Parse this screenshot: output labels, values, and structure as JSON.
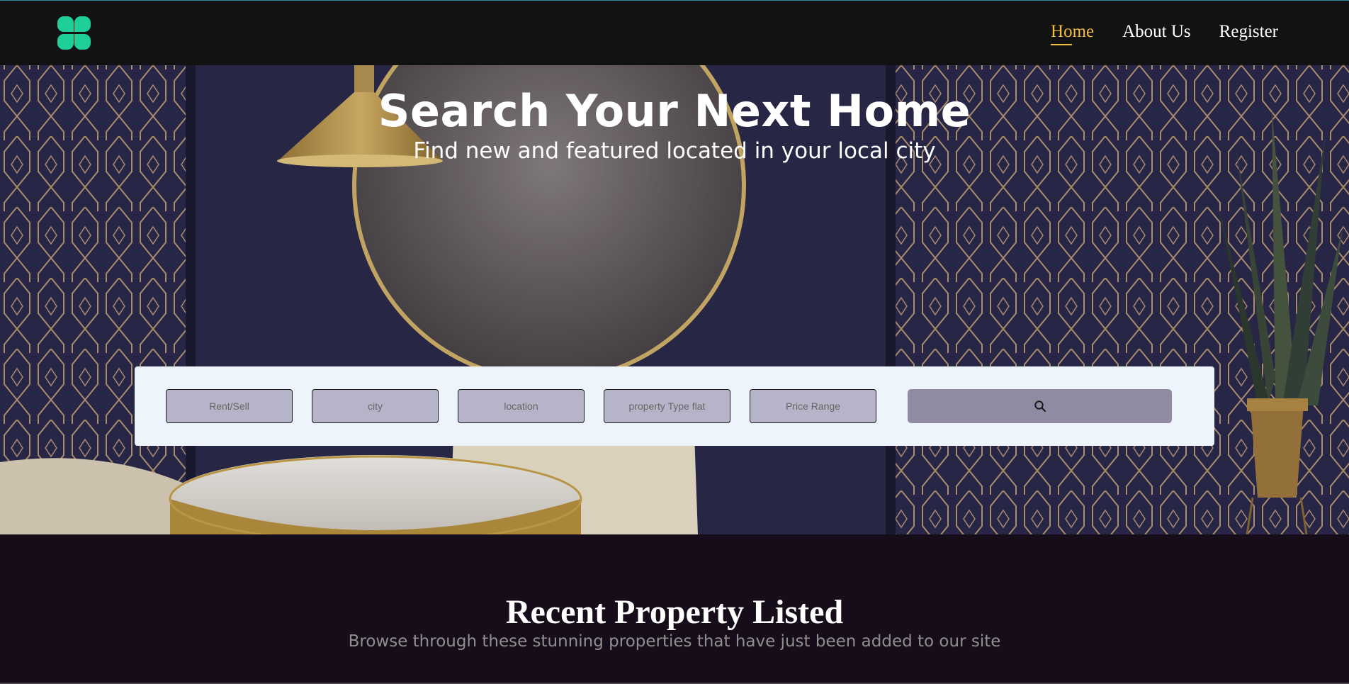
{
  "brand": {
    "logo_icon": "four-petal-logo-icon",
    "accent": "#1fcf9a"
  },
  "nav": {
    "items": [
      {
        "label": "Home",
        "active": true
      },
      {
        "label": "About Us",
        "active": false
      },
      {
        "label": "Register",
        "active": false
      }
    ],
    "active_color": "#f3bd3d"
  },
  "hero": {
    "title": "Search Your Next Home",
    "subtitle": "Find new and featured located in your local city"
  },
  "search": {
    "filters": [
      {
        "label": "Rent/Sell"
      },
      {
        "label": "city"
      },
      {
        "label": "location"
      },
      {
        "label": "property Type flat"
      },
      {
        "label": "Price Range"
      }
    ],
    "button_icon": "search-icon"
  },
  "recent": {
    "title": "Recent Property Listed",
    "subtitle": "Browse through these stunning properties that have just been added to our site"
  }
}
